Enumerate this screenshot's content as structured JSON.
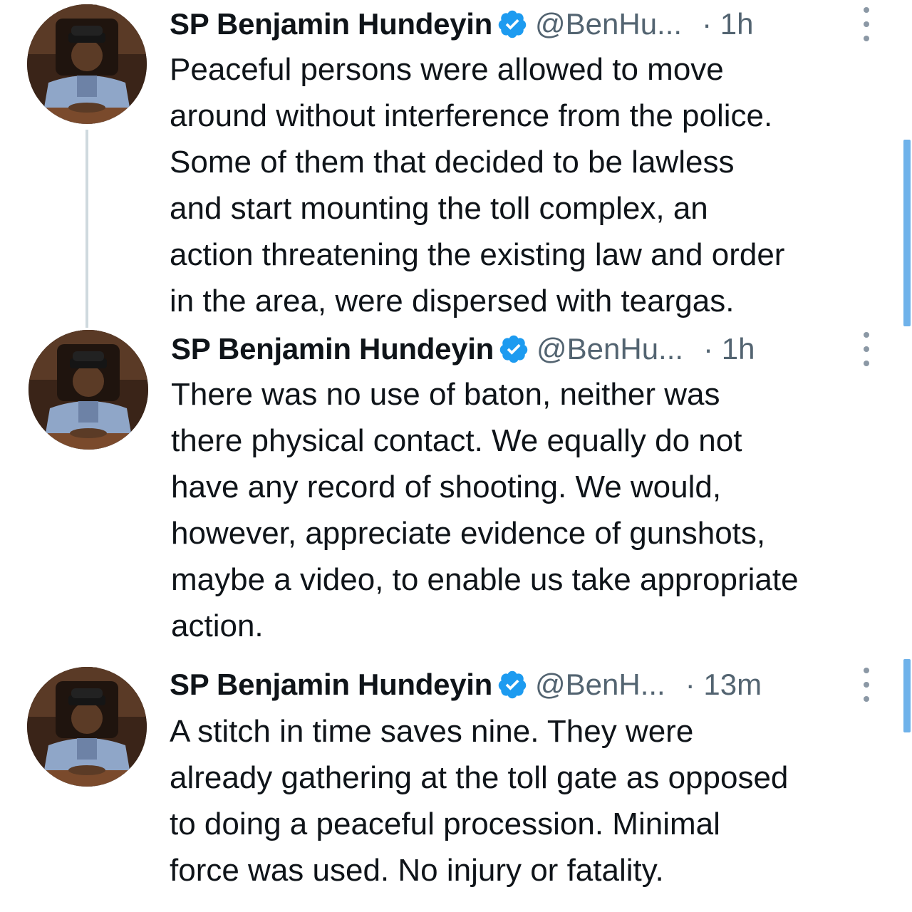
{
  "tweets": [
    {
      "name": "SP Benjamin Hundeyin",
      "handle": "@BenHu...",
      "time": "· 1h",
      "lines": [
        "Peaceful persons were allowed to move",
        "around without interference from the police.",
        "Some of them that decided to be lawless",
        "and start mounting the toll complex, an",
        "action threatening the existing law and order",
        "in the area, were dispersed with teargas."
      ]
    },
    {
      "name": "SP Benjamin Hundeyin",
      "handle": "@BenHu...",
      "time": "· 1h",
      "lines": [
        "There was no use of baton, neither was",
        "there physical contact. We equally do not",
        "have any record of shooting. We would,",
        "however, appreciate evidence of gunshots,",
        "maybe a video, to enable us take appropriate",
        "action."
      ]
    },
    {
      "name": "SP Benjamin Hundeyin",
      "handle": "@BenH...",
      "time": "· 13m",
      "lines": [
        "A stitch in time saves nine. They were",
        "already gathering at the toll gate as opposed",
        "to doing a peaceful procession. Minimal",
        "force was used. No injury or fatality."
      ]
    }
  ],
  "colors": {
    "verified": "#1d9bf0",
    "secondary_text": "#536471",
    "thread_line": "#cfd9de",
    "scroll_indicator": "#6fb2ea"
  },
  "icons": {
    "verified": "verified-badge-icon",
    "more": "more-vertical-icon"
  }
}
